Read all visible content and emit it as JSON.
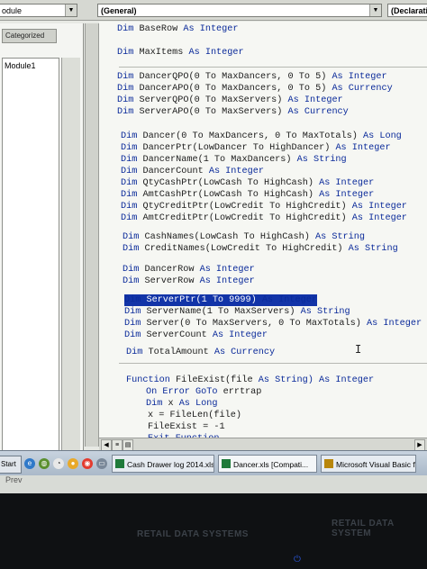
{
  "toolbar": {
    "left_combo": "odule",
    "general_combo": "(General)",
    "declarations_combo": "(Declaratio"
  },
  "project": {
    "tab_label": "Categorized",
    "module_item": "Module1"
  },
  "code_lines": [
    {
      "k": "Dim",
      "r": " BaseRow ",
      "t": "As Integer"
    },
    {
      "k": "Dim",
      "r": " MaxItems ",
      "t": "As Integer"
    },
    {
      "k": "Dim",
      "r": " DancerQPO(0 To MaxDancers, 0 To 5) ",
      "t": "As Integer"
    },
    {
      "k": "Dim",
      "r": " DancerAPO(0 To MaxDancers, 0 To 5) ",
      "t": "As Currency"
    },
    {
      "k": "Dim",
      "r": " ServerQPO(0 To MaxServers) ",
      "t": "As Integer"
    },
    {
      "k": "Dim",
      "r": " ServerAPO(0 To MaxServers) ",
      "t": "As Currency"
    },
    {
      "k": "Dim",
      "r": " Dancer(0 To MaxDancers, 0 To MaxTotals) ",
      "t": "As Long"
    },
    {
      "k": "Dim",
      "r": " DancerPtr(LowDancer To HighDancer) ",
      "t": "As Integer"
    },
    {
      "k": "Dim",
      "r": " DancerName(1 To MaxDancers) ",
      "t": "As String"
    },
    {
      "k": "Dim",
      "r": " DancerCount ",
      "t": "As Integer"
    },
    {
      "k": "Dim",
      "r": " QtyCashPtr(LowCash To HighCash) ",
      "t": "As Integer"
    },
    {
      "k": "Dim",
      "r": " AmtCashPtr(LowCash To HighCash) ",
      "t": "As Integer"
    },
    {
      "k": "Dim",
      "r": " QtyCreditPtr(LowCredit To HighCredit) ",
      "t": "As Integer"
    },
    {
      "k": "Dim",
      "r": " AmtCreditPtr(LowCredit To HighCredit) ",
      "t": "As Integer"
    },
    {
      "k": "Dim",
      "r": " CashNames(LowCash To HighCash) ",
      "t": "As String"
    },
    {
      "k": "Dim",
      "r": " CreditNames(LowCredit To HighCredit) ",
      "t": "As String"
    },
    {
      "k": "Dim",
      "r": " DancerRow ",
      "t": "As Integer"
    },
    {
      "k": "Dim",
      "r": " ServerRow ",
      "t": "As Integer"
    },
    {
      "k": "Dim",
      "r": " ServerPtr(1 To 9999) ",
      "t": "As Integer"
    },
    {
      "k": "Dim",
      "r": " ServerName(1 To MaxServers) ",
      "t": "As String"
    },
    {
      "k": "Dim",
      "r": " Server(0 To MaxServers, 0 To MaxTotals) ",
      "t": "As Integer"
    },
    {
      "k": "Dim",
      "r": " ServerCount ",
      "t": "As Integer"
    },
    {
      "k": "Dim",
      "r": " TotalAmount ",
      "t": "As Currency"
    },
    {
      "k": "Function",
      "r": " FileExist(file ",
      "t": "As String) As Integer"
    },
    {
      "k": "On Error GoTo",
      "r": " errtrap",
      "t": ""
    },
    {
      "k": "Dim",
      "r": " x ",
      "t": "As Long"
    },
    {
      "k": "",
      "r": "x = FileLen(file)",
      "t": ""
    },
    {
      "k": "",
      "r": "FileExist = -1",
      "t": ""
    },
    {
      "k": "Exit Function",
      "r": "",
      "t": ""
    }
  ],
  "taskbar": {
    "start_label": "Start",
    "buttons": [
      {
        "label": "Cash Drawer log 2014.xlsx"
      },
      {
        "label": "Dancer.xls  [Compati..."
      },
      {
        "label": "Microsoft Visual Basic for ..."
      }
    ]
  },
  "below_taskbar_text": "Prev",
  "bezel": {
    "reflection_1": "RETAIL DATA SYSTEMS",
    "reflection_2": "RETAIL DATA SYSTEM"
  }
}
